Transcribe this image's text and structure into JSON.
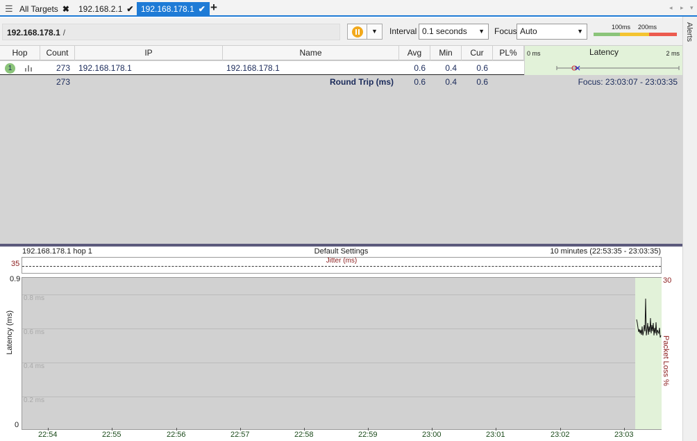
{
  "tabs": {
    "all_targets": "All Targets",
    "items": [
      {
        "label": "192.168.2.1"
      },
      {
        "label": "192.168.178.1"
      }
    ]
  },
  "toolbar": {
    "breadcrumb": "192.168.178.1",
    "breadcrumb_sep": "/",
    "interval_label": "Interval",
    "interval_value": "0.1 seconds",
    "focus_label": "Focus",
    "focus_value": "Auto",
    "scale_100": "100ms",
    "scale_200": "200ms"
  },
  "alerts_label": "Alerts",
  "grid": {
    "headers": {
      "hop": "Hop",
      "count": "Count",
      "ip": "IP",
      "name": "Name",
      "avg": "Avg",
      "min": "Min",
      "cur": "Cur",
      "pl": "PL%",
      "latency": "Latency"
    },
    "latency_lo": "0 ms",
    "latency_hi": "2 ms",
    "row": {
      "hop": "1",
      "count": "273",
      "ip": "192.168.178.1",
      "name": "192.168.178.1",
      "avg": "0.6",
      "min": "0.4",
      "cur": "0.6",
      "pl": ""
    },
    "summary": {
      "count": "273",
      "label": "Round Trip (ms)",
      "avg": "0.6",
      "min": "0.4",
      "cur": "0.6",
      "focus": "Focus: 23:03:07 - 23:03:35"
    }
  },
  "graph": {
    "target": "192.168.178.1 hop 1",
    "settings": "Default Settings",
    "range": "10 minutes (22:53:35 - 23:03:35)",
    "jitter_label": "Jitter (ms)",
    "jitter_max": "35",
    "y_max": "0.9",
    "y_min": "0",
    "y_grid": [
      "0.8 ms",
      "0.6 ms",
      "0.4 ms",
      "0.2 ms"
    ],
    "y_axis": "Latency (ms)",
    "y2_max": "30",
    "y2_axis": "Packet Loss %",
    "x_ticks": [
      "22:54",
      "22:55",
      "22:56",
      "22:57",
      "22:58",
      "22:59",
      "23:00",
      "23:01",
      "23:02",
      "23:03"
    ]
  },
  "colors": {
    "accent": "#1e7bd6",
    "good": "#8bc47a",
    "warn": "#f4c431",
    "bad": "#ec5b4f",
    "pause": "#f2a91c"
  }
}
